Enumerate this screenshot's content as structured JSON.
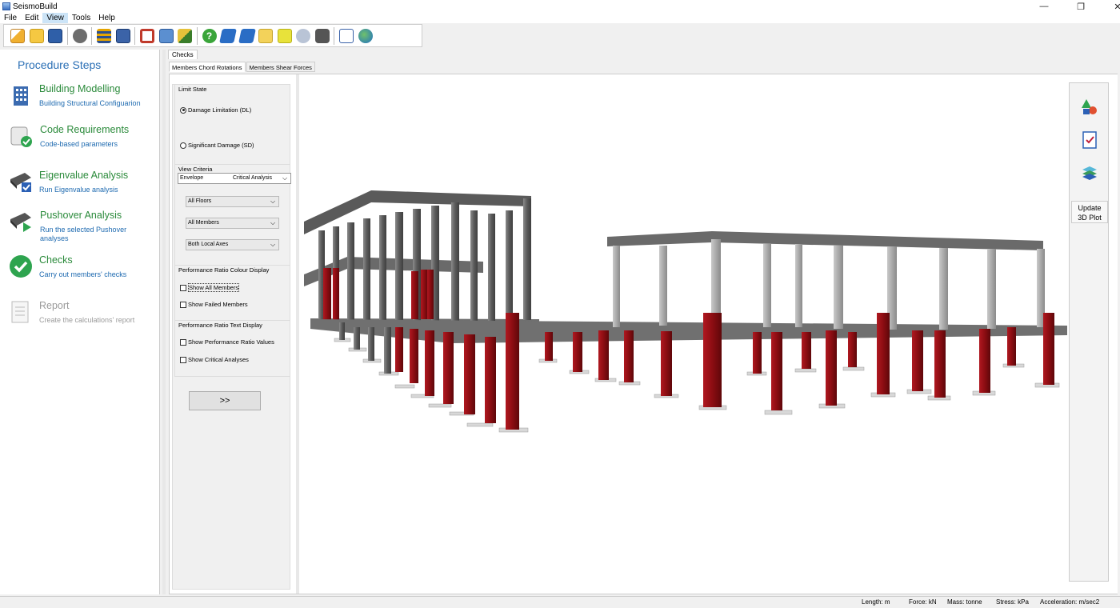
{
  "window": {
    "title": "SeismoBuild"
  },
  "menu": [
    "File",
    "Edit",
    "View",
    "Tools",
    "Help"
  ],
  "toolbar": {
    "icons": [
      "new-file-icon",
      "open-folder-icon",
      "save-icon",
      "engine-icon",
      "layers-icon",
      "document-icon",
      "frame-icon",
      "calculator-icon",
      "brush-icon",
      "help-icon",
      "book-icon",
      "book-icon",
      "folder-icon",
      "folder-icon",
      "chat-icon",
      "camera-icon",
      "edit-icon",
      "globe-icon"
    ]
  },
  "procedure": {
    "title": "Procedure Steps",
    "steps": [
      {
        "name": "Building Modelling",
        "desc": "Building Structural Configuarion",
        "icon": "building-icon",
        "enabled": true
      },
      {
        "name": "Code Requirements",
        "desc": "Code-based parameters",
        "icon": "scroll-check-icon",
        "enabled": true
      },
      {
        "name": "Eigenvalue Analysis",
        "desc": "Run Eigenvalue analysis",
        "icon": "engine-check-icon",
        "enabled": true
      },
      {
        "name": "Pushover Analysis",
        "desc": "Run the selected Pushover analyses",
        "icon": "engine-play-icon",
        "enabled": true
      },
      {
        "name": "Checks",
        "desc": "Carry out members' checks",
        "icon": "green-check-icon",
        "enabled": true
      },
      {
        "name": "Report",
        "desc": "Create the calculations' report",
        "icon": "report-icon",
        "enabled": false
      }
    ]
  },
  "tabs": {
    "main": "Checks",
    "sub": [
      "Members Chord Rotations",
      "Members Shear Forces"
    ]
  },
  "controls": {
    "limit_state": {
      "title": "Limit State",
      "options": [
        "Damage Limitation (DL)",
        "Significant Damage (SD)"
      ],
      "selected": "Damage Limitation (DL)"
    },
    "view_criteria": {
      "title": "View Criteria",
      "envelope": "Envelope",
      "analysis": "Critical Analysis",
      "floors": "All Floors",
      "members": "All Members",
      "axes": "Both Local Axes"
    },
    "colour_display": {
      "title": "Performance Ratio Colour Display",
      "show_all": "Show All Members",
      "show_failed": "Show Failed Members"
    },
    "text_display": {
      "title": "Performance Ratio Text Display",
      "show_values": "Show Performance Ratio Values",
      "show_critical": "Show Critical Analyses"
    },
    "go_button": ">>"
  },
  "right_tools": {
    "icons": [
      "shapes-icon",
      "checklist-icon",
      "layers-stack-icon"
    ],
    "update_label": "Update 3D Plot"
  },
  "status": {
    "length": "Length: m",
    "force": "Force: kN",
    "mass": "Mass: tonne",
    "stress": "Stress: kPa",
    "accel": "Acceleration: m/sec2"
  },
  "colors": {
    "accent": "#2a6fb5",
    "step_name": "#2a8a3a",
    "failed_member": "#8b0d12",
    "structure": "#6b6b6b"
  }
}
